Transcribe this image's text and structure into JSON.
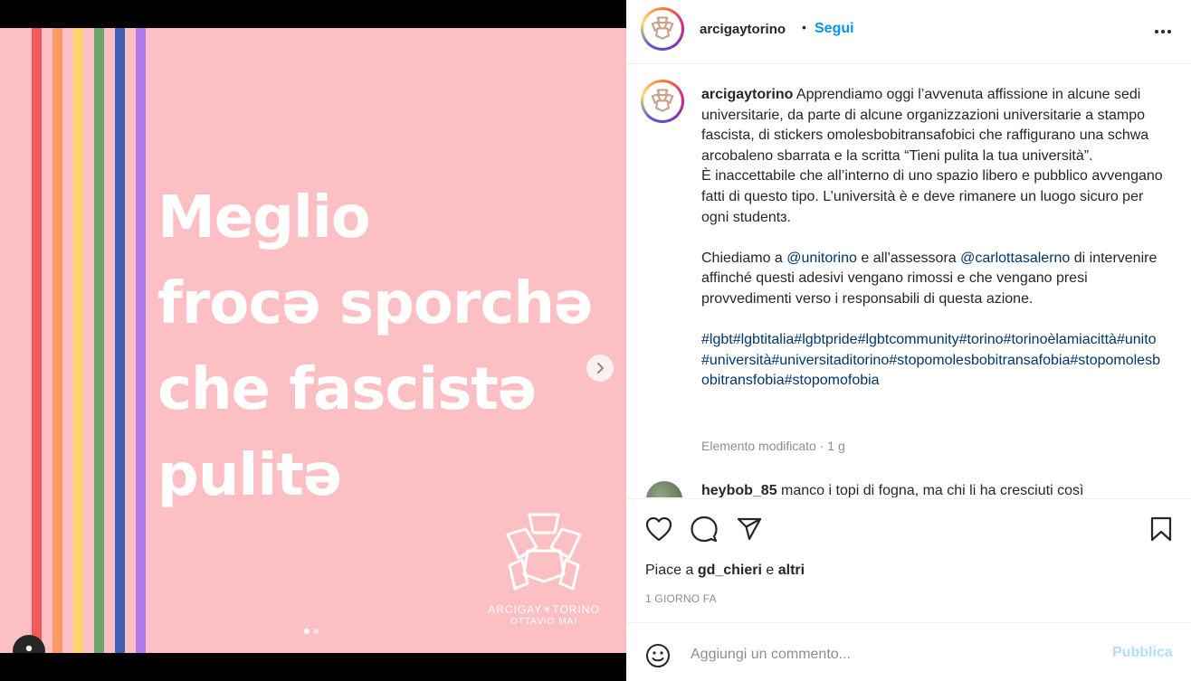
{
  "post": {
    "slide": {
      "headline_lines": [
        "Meglio",
        "frocə sporchə",
        "che fascistə",
        "pulitə"
      ],
      "stripe_colors": [
        "#f25a5a",
        "#fb9a62",
        "#fbd36f",
        "#6aa56d",
        "#4060b5",
        "#b07aed"
      ],
      "logo_name": "ARCIGAY✳TORINO",
      "logo_sub": "OTTAVIO MAI",
      "slide_count": 2,
      "active_slide": 1
    }
  },
  "header": {
    "username": "arcigaytorino",
    "separator": "•",
    "follow_label": "Segui"
  },
  "caption": {
    "username": "arcigaytorino",
    "p1": "Apprendiamo oggi l’avvenuta affissione in alcune sedi universitarie, da parte di alcune organizzazioni universitarie a stampo fascista, di stickers omolesbobitransafobici che raffigurano una schwa arcobaleno sbarrata e la scritta “Tieni pulita la tua università”.\nÈ inaccettabile che all’interno di uno spazio libero e pubblico avvengano fatti di questo tipo. L’università è e deve rimanere un luogo sicuro per ogni studentɜ.",
    "p2_a": "Chiediamo a ",
    "mention1": "@unitorino",
    "p2_b": " e all'assessora ",
    "mention2": "@carlottasalerno",
    "p2_c": " di intervenire affinché questi adesivi vengano rimossi e che vengano presi provvedimenti verso i responsabili di questa azione.",
    "hashtags": "#lgbt#lgbtitalia#lgbtpride#lgbtcommunity#torino#torinoèlamiacittà#unito#università#universitaditorino#stopomolesbobitransafobia#stopomolesbobitransfobia#stopomofobia",
    "meta": "Elemento modificato · 1 g"
  },
  "comment": {
    "username": "heybob_85",
    "text": "manco i topi di fogna, ma chi li ha cresciuti così"
  },
  "actions": {
    "likes_prefix": "Piace a ",
    "likes_user": "gd_chieri",
    "likes_mid": " e ",
    "likes_others": "altri",
    "time": "1 GIORNO FA"
  },
  "add_comment": {
    "placeholder": "Aggiungi un commento...",
    "publish_label": "Pubblica"
  },
  "icons": [
    "more-icon",
    "heart-icon",
    "comment-icon",
    "share-icon",
    "bookmark-icon",
    "emoji-icon",
    "chevron-right-icon",
    "user-tag-icon"
  ]
}
